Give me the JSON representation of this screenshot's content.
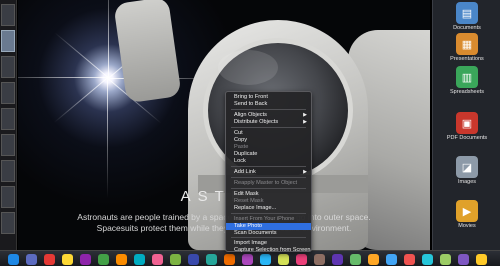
{
  "slide": {
    "headline": "ASTRO",
    "body_line_1": "Astronauts are people trained by a spaceflight program to go into outer space.",
    "body_line_2": "Spacesuits protect them while they work in this hostile environment."
  },
  "context_menu": {
    "items": [
      {
        "label": "Bring to Front",
        "state": "enabled"
      },
      {
        "label": "Send to Back",
        "state": "enabled"
      },
      {
        "label": "Align Objects",
        "state": "enabled",
        "submenu": true
      },
      {
        "label": "Distribute Objects",
        "state": "enabled",
        "submenu": true
      },
      {
        "label": "Cut",
        "state": "enabled"
      },
      {
        "label": "Copy",
        "state": "enabled"
      },
      {
        "label": "Paste",
        "state": "disabled"
      },
      {
        "label": "Duplicate",
        "state": "enabled"
      },
      {
        "label": "Lock",
        "state": "enabled"
      },
      {
        "label": "Add Link",
        "state": "enabled",
        "submenu": true
      },
      {
        "label": "Reapply Master to Object",
        "state": "disabled"
      },
      {
        "label": "Edit Mask",
        "state": "enabled"
      },
      {
        "label": "Reset Mask",
        "state": "disabled"
      },
      {
        "label": "Replace Image...",
        "state": "enabled"
      },
      {
        "label": "Insert From Your iPhone",
        "state": "disabled"
      },
      {
        "label": "Take Photo",
        "state": "highlighted"
      },
      {
        "label": "Scan Documents",
        "state": "enabled"
      },
      {
        "label": "Import Image",
        "state": "enabled"
      },
      {
        "label": "Capture Selection from Screen",
        "state": "enabled"
      }
    ]
  },
  "right_panel": {
    "apps": [
      {
        "label": "Documents",
        "icon": "documents-icon",
        "color": "#4a86c8"
      },
      {
        "label": "Presentations",
        "icon": "presentations-icon",
        "color": "#d98b2f"
      },
      {
        "label": "Spreadsheets",
        "icon": "spreadsheets-icon",
        "color": "#3aa65a"
      },
      {
        "label": "PDF Documents",
        "icon": "pdf-icon",
        "color": "#c9372c"
      },
      {
        "label": "Images",
        "icon": "images-icon",
        "color": "#8d9aa8"
      },
      {
        "label": "Movies",
        "icon": "movies-icon",
        "color": "#e0a12a"
      }
    ]
  },
  "dock": {
    "icon_colors": [
      "#1e88e5",
      "#5c6bc0",
      "#e53935",
      "#fdd835",
      "#8e24aa",
      "#43a047",
      "#fb8c00",
      "#00acc1",
      "#f06292",
      "#7cb342",
      "#3949ab",
      "#26a69a",
      "#ef6c00",
      "#ab47bc",
      "#29b6f6",
      "#d4e157",
      "#ec407a",
      "#8d6e63",
      "#5e35b1",
      "#66bb6a",
      "#ffa726",
      "#42a5f5",
      "#ef5350",
      "#26c6da",
      "#9ccc65",
      "#7e57c2",
      "#ffca28"
    ]
  }
}
